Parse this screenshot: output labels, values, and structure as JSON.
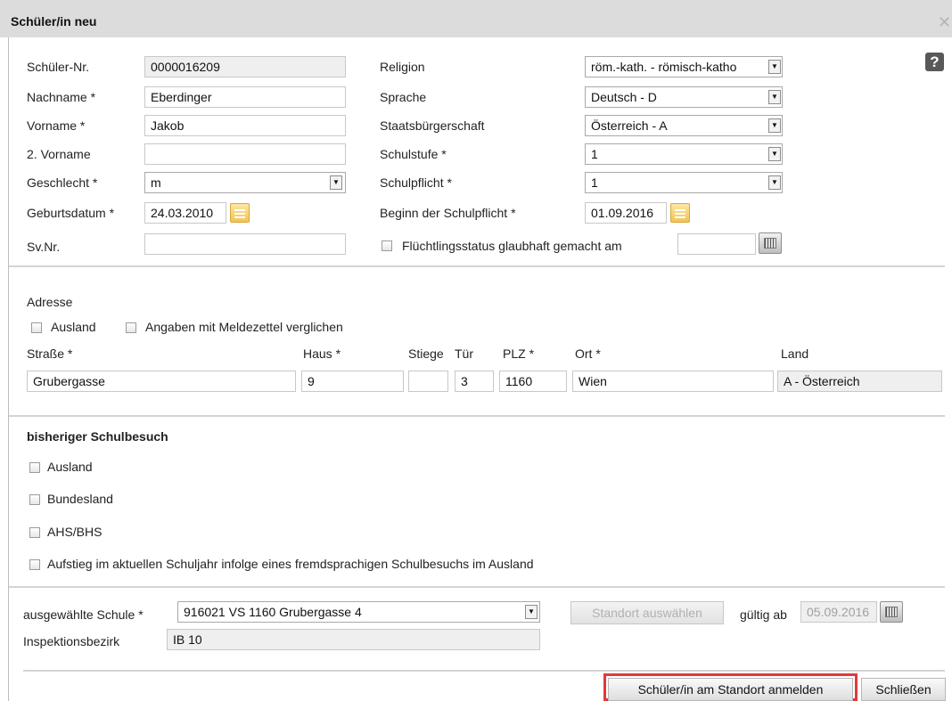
{
  "window": {
    "title": "Schüler/in neu"
  },
  "left": {
    "schueler_nr": {
      "label": "Schüler-Nr.",
      "value": "0000016209"
    },
    "nachname": {
      "label": "Nachname *",
      "value": "Eberdinger"
    },
    "vorname": {
      "label": "Vorname *",
      "value": "Jakob"
    },
    "vorname2": {
      "label": "2. Vorname",
      "value": ""
    },
    "geschlecht": {
      "label": "Geschlecht *",
      "value": "m"
    },
    "geburtsdatum": {
      "label": "Geburtsdatum *",
      "value": "24.03.2010"
    },
    "svnr": {
      "label": "Sv.Nr.",
      "value": ""
    }
  },
  "right": {
    "religion": {
      "label": "Religion",
      "value": "röm.-kath. - römisch-katho"
    },
    "sprache": {
      "label": "Sprache",
      "value": "Deutsch - D"
    },
    "staatsbuergerschaft": {
      "label": "Staatsbürgerschaft",
      "value": "Österreich - A"
    },
    "schulstufe": {
      "label": "Schulstufe *",
      "value": "1"
    },
    "schulpflicht": {
      "label": "Schulpflicht *",
      "value": "1"
    },
    "beginn_schulpflicht": {
      "label": "Beginn der Schulpflicht *",
      "value": "01.09.2016"
    },
    "fluechtling": {
      "label": "Flüchtlingsstatus glaubhaft gemacht am",
      "value": ""
    }
  },
  "adresse": {
    "heading": "Adresse",
    "ausland_label": "Ausland",
    "meldezettel_label": "Angaben mit Meldezettel verglichen",
    "strasse_label": "Straße *",
    "strasse": "Grubergasse",
    "haus_label": "Haus *",
    "haus": "9",
    "stiege_label": "Stiege",
    "stiege": "",
    "tuer_label": "Tür",
    "tuer": "3",
    "plz_label": "PLZ *",
    "plz": "1160",
    "ort_label": "Ort *",
    "ort": "Wien",
    "land_label": "Land",
    "land": "A - Österreich"
  },
  "schulbesuch": {
    "heading": "bisheriger Schulbesuch",
    "options": [
      "Ausland",
      "Bundesland",
      "AHS/BHS",
      "Aufstieg im aktuellen Schuljahr infolge eines fremdsprachigen Schulbesuchs im Ausland"
    ]
  },
  "schule": {
    "label": "ausgewählte Schule *",
    "value": "916021 VS 1160 Grubergasse 4",
    "standort_button": "Standort auswählen",
    "gueltig_label": "gültig ab",
    "gueltig_value": "05.09.2016",
    "inspektion_label": "Inspektionsbezirk",
    "inspektion_value": "IB 10"
  },
  "footer": {
    "anmelden_button": "Schüler/in am Standort anmelden",
    "schliessen_button": "Schließen"
  },
  "icons": {
    "help": "question-mark-icon",
    "close": "close-x-icon",
    "calendar": "calendar-icon",
    "dropdown": "chevron-down-icon"
  },
  "colors": {
    "titlebar": "#dcdcdc",
    "highlight": "#e03a3a",
    "calendar": "#f3c352"
  }
}
